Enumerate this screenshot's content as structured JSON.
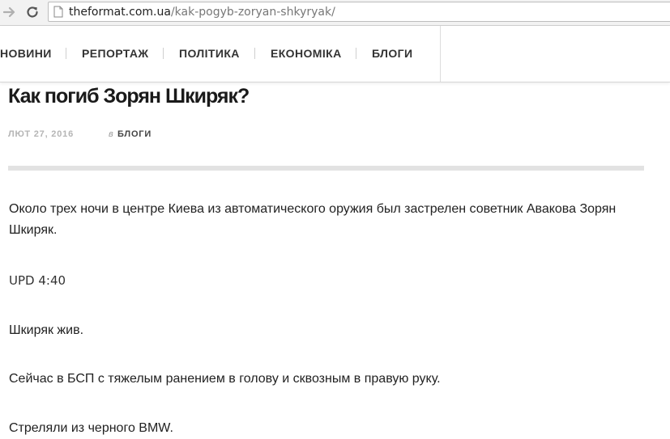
{
  "browser": {
    "url_domain": "theformat.com.ua",
    "url_path": "/kak-pogyb-zoryan-shkyryak/",
    "forward_icon": "arrow-right-icon",
    "reload_icon": "reload-icon",
    "page_icon": "page-icon"
  },
  "nav": {
    "items": [
      {
        "label": "НОВИНИ"
      },
      {
        "label": "РЕПОРТАЖ"
      },
      {
        "label": "ПОЛІТИКА"
      },
      {
        "label": "ЕКОНОМІКА"
      },
      {
        "label": "БЛОГИ"
      }
    ]
  },
  "article": {
    "title": "Как погиб Зорян Шкиряк?",
    "date": "ЛЮТ 27, 2016",
    "in_label": "в",
    "category": "БЛОГИ",
    "paragraphs": [
      "Около трех ночи в центре Киева из автоматического оружия был застрелен советник Авакова Зорян Шкиряк.",
      "UPD 4:40",
      "Шкиряк жив.",
      "Сейчас в БСП с тяжелым ранением в голову и сквозным в правую руку.",
      "Стреляли из черного BMW."
    ]
  },
  "colors": {
    "nav_text": "#333333",
    "meta_date": "#b5b5b5",
    "rule": "#e2e2e2"
  }
}
